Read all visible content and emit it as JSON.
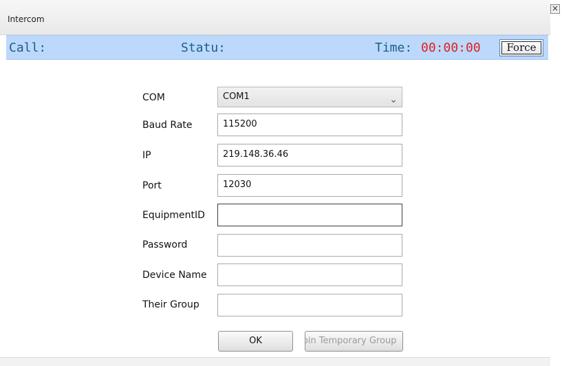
{
  "window": {
    "title": "Intercom",
    "close_glyph": "×"
  },
  "status_bar": {
    "call_label": "Call:",
    "status_label": "Statu:",
    "time_label": "Time:",
    "time_value": "00:00:00",
    "force_button": "Force"
  },
  "form": {
    "com": {
      "label": "COM",
      "value": "COM1"
    },
    "baud_rate": {
      "label": "Baud Rate",
      "value": "115200"
    },
    "ip": {
      "label": "IP",
      "value": "219.148.36.46"
    },
    "port": {
      "label": "Port",
      "value": "12030"
    },
    "equipment_id": {
      "label": "EquipmentID",
      "value": ""
    },
    "password": {
      "label": "Password",
      "value": ""
    },
    "device_name": {
      "label": "Device Name",
      "value": ""
    },
    "their_group": {
      "label": "Their Group",
      "value": ""
    }
  },
  "buttons": {
    "ok": "OK",
    "join_group": "Join Temporary Group"
  },
  "colors": {
    "status_strip_bg": "#bcd9fb",
    "time_value": "#e02020"
  }
}
